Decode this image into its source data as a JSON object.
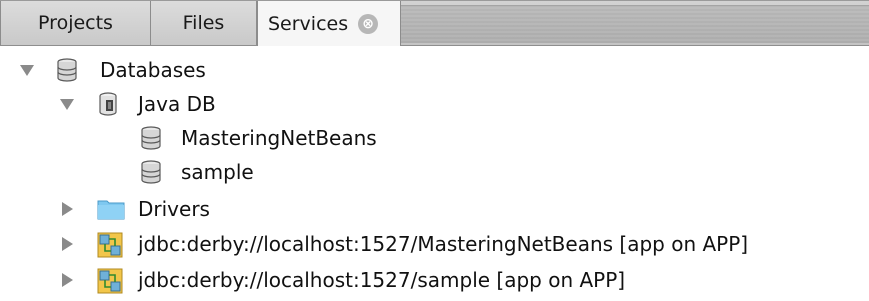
{
  "tabs": [
    {
      "label": "Projects",
      "active": false
    },
    {
      "label": "Files",
      "active": false
    },
    {
      "label": "Services",
      "active": true,
      "closable": true
    }
  ],
  "tab_close_glyph": "⊗",
  "tree": {
    "databases": {
      "label": "Databases",
      "expanded": true,
      "icon": "database-icon"
    },
    "java_db": {
      "label": "Java DB",
      "expanded": true,
      "icon": "java-db-server-icon"
    },
    "db_mastering": {
      "label": "MasteringNetBeans",
      "icon": "database-icon"
    },
    "db_sample": {
      "label": "sample",
      "icon": "database-icon"
    },
    "drivers": {
      "label": "Drivers",
      "expanded": false,
      "icon": "folder-icon"
    },
    "conn_mastering": {
      "label": "jdbc:derby://localhost:1527/MasteringNetBeans [app on APP]",
      "expanded": false,
      "icon": "connection-icon"
    },
    "conn_sample": {
      "label": "jdbc:derby://localhost:1527/sample [app on APP]",
      "expanded": false,
      "icon": "connection-icon"
    }
  },
  "colors": {
    "folder": "#7ec8f0",
    "db_icon": "#8c8c8c",
    "connection_icon": "#f0c040",
    "active_tab": "#f6f6f6"
  }
}
